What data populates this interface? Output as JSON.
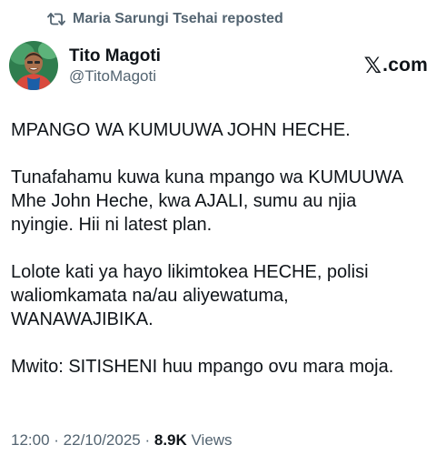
{
  "repost": {
    "icon": "repost-icon",
    "text": "Maria Sarungi Tsehai reposted"
  },
  "author": {
    "display_name": "Tito Magoti",
    "handle": "@TitoMagoti",
    "avatar_icon": "avatar"
  },
  "brand": {
    "x_glyph": "𝕏",
    "suffix": ".com"
  },
  "tweet": {
    "paragraphs": [
      "MPANGO WA KUMUUWA JOHN HECHE.",
      "Tunafahamu kuwa kuna mpango wa KUMUUWA\nMhe John Heche, kwa AJALI, sumu au njia\nnyingie. Hii ni latest plan.",
      "Lolote kati ya hayo likimtokea HECHE, polisi\nwaliomkamata na/au aliyewatuma,\nWANAWAJIBIKA.",
      "Mwito: SITISHENI huu mpango ovu mara moja."
    ]
  },
  "meta": {
    "time": "12:00",
    "separator_1": " · ",
    "date": "22/10/2025",
    "separator_2": " · ",
    "views_count": "8.9K",
    "views_label": " Views"
  },
  "colors": {
    "text_primary": "#0f1419",
    "text_secondary": "#536471",
    "background": "#ffffff"
  }
}
